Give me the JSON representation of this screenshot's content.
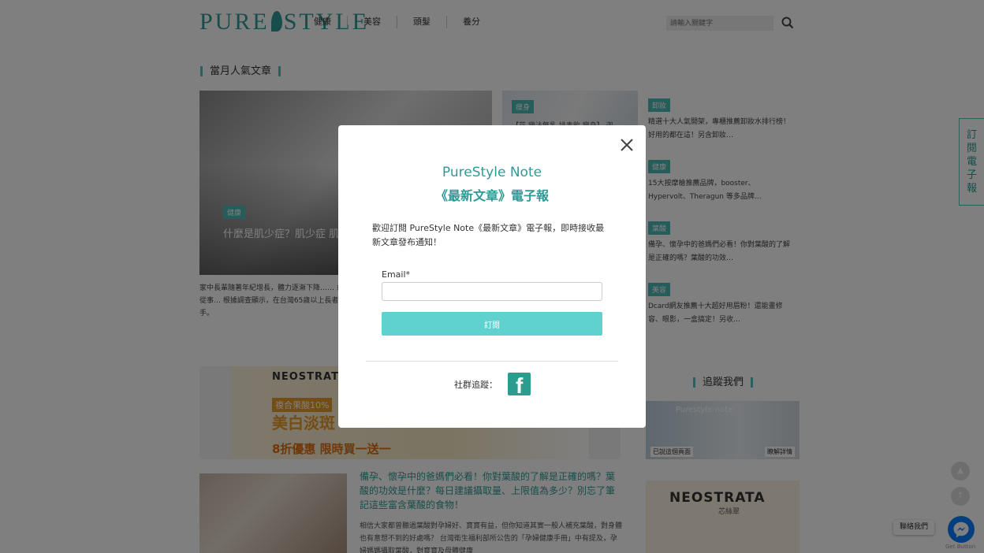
{
  "header": {
    "logo": "PURE STYLE",
    "nav": [
      "健康",
      "美容",
      "頭髮",
      "養分"
    ],
    "search_placeholder": "請輸入關鍵字"
  },
  "popular": {
    "title": "當月人氣文章",
    "hero": {
      "tag": "健康",
      "title": "什麼是肌少症？肌少症 肌少症檢測法你不可不知",
      "excerpt": "家中長輩隨著年紀增長，體力逐漸下降…… 或是長期臥病在床，缺乏運動的原因，患者也難以從事… 根據調查顯示，在台灣65歲以上長者中，約有8-10%罹患肌少症，堪稱老年失能的兇手。"
    },
    "mid": {
      "tag": "瘦身",
      "title": "【花 瘦法無乳 排毒飲 瘦身】 迦"
    },
    "side": [
      {
        "tag": "卸妝",
        "text": "精選十大人氣開架，專櫃推薦卸妝水排行榜！好用的都在這！另含卸妝…"
      },
      {
        "tag": "健康",
        "text": "15大按摩槍推薦品牌，booster、Hypervolt、Theragun 等多品牌…"
      },
      {
        "tag": "葉酸",
        "text": "備孕、懷孕中的爸媽們必看！你對葉酸的了解是正確的嗎？葉酸的功效…"
      },
      {
        "tag": "美容",
        "text": "Dcard網友推薦十大超好用眉粉！還能畫修容、眼影，一盒搞定！另收…"
      }
    ]
  },
  "ad_banner": {
    "brand": "NEOSTRATA",
    "line1": "複合果酸10%",
    "line2": "美白淡斑",
    "line3": "8折優惠 限時買一送一"
  },
  "article": {
    "title": "備孕、懷孕中的爸媽們必看！你對葉酸的了解是正確的嗎？葉酸的功效是什麼？每日建議攝取量、上限值為多少？別忘了筆記這些富含葉酸的食物！",
    "excerpt": "相信大家都曾聽過葉酸對孕婦好、寶寶有益，但你知道其實一般人補充葉酸，對身體也有意想不到的好處嗎？ 台灣衛生福利部所公告的「孕婦健康手冊」中有提及，孕婦媽媽攝取葉酸，對寶寶及母體健康"
  },
  "follow": {
    "title": "追蹤我們",
    "page_name": "Purestyle-note",
    "button_left": "已說這個頁面",
    "button_right": "瞭解詳情"
  },
  "side_ad": {
    "brand": "NEOSTRATA",
    "sub": "芯絲翠"
  },
  "subscribe_tab": [
    "訂",
    "閱",
    "電",
    "子",
    "報"
  ],
  "contact": {
    "label": "聯絡我們",
    "get_button": "Get Button"
  },
  "modal": {
    "title_line1": "PureStyle Note",
    "title_line2": "《最新文章》電子報",
    "description": "歡迎訂閱 PureStyle Note《最新文章》電子報，即時接收最新文章發布通知！",
    "email_label": "Email*",
    "email_value": "",
    "submit_label": "訂閱",
    "social_label": "社群追蹤："
  },
  "colors": {
    "brand": "#2e9a95",
    "accent": "#4fc3c0",
    "button": "#5fd2d0"
  }
}
